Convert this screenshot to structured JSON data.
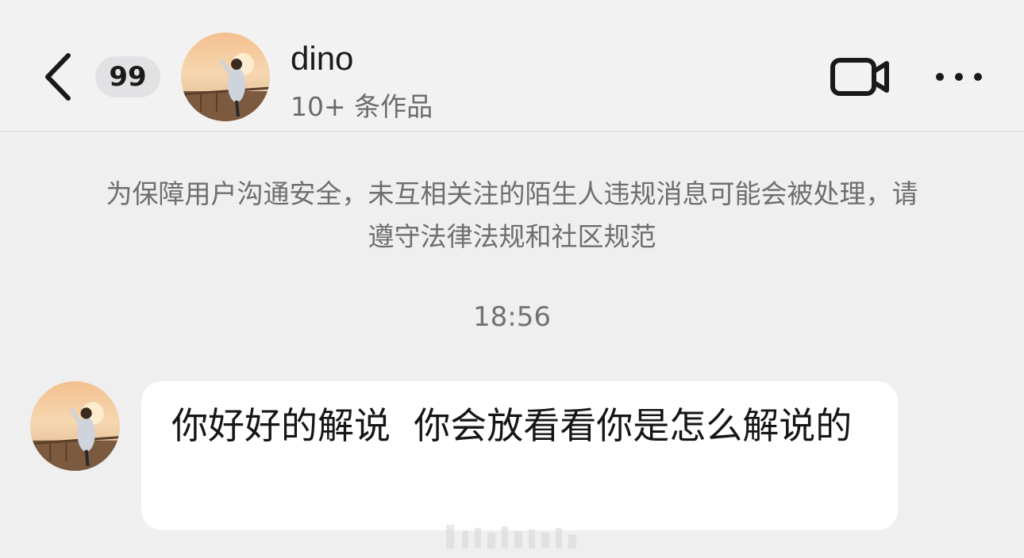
{
  "header": {
    "back_icon": "chevron-left-icon",
    "unread_count": "99",
    "contact_name": "dino",
    "contact_subtitle": "10+ 条作品",
    "video_icon": "video-camera-icon",
    "more_icon": "more-horizontal-icon"
  },
  "chat": {
    "notice": "为保障用户沟通安全，未互相关注的陌生人违规消息可能会被处理，请遵守法律法规和社区规范",
    "timestamp": "18:56",
    "messages": [
      {
        "sender": "dino",
        "text": "你好好的解说  你会放看看你是怎么解说的"
      }
    ]
  },
  "colors": {
    "background": "#efeff0",
    "bubble": "#ffffff",
    "badge": "#e2e2e4",
    "muted_text": "#6e6e6e"
  }
}
